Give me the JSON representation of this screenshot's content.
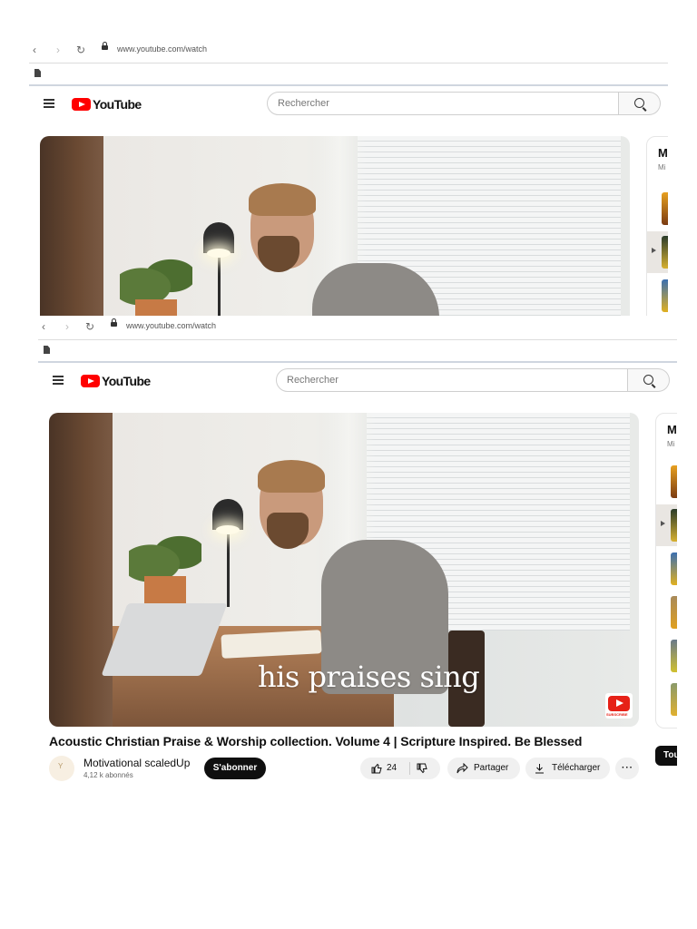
{
  "browser": {
    "url": "www.youtube.com/watch"
  },
  "header": {
    "logo_text": "YouTube",
    "search_placeholder": "Rechercher"
  },
  "video": {
    "caption": "his praises sing",
    "subscribe_badge_text": "SUBSCRIBE",
    "title": "Acoustic Christian Praise & Worship collection. Volume 4 | Scripture Inspired. Be Blessed"
  },
  "channel": {
    "name": "Motivational scaledUp",
    "subscribers": "4,12 k abonnés",
    "subscribe_label": "S'abonner"
  },
  "actions": {
    "likes": "24",
    "share_label": "Partager",
    "download_label": "Télécharger",
    "more_label": "···"
  },
  "sidebar": {
    "title_partial": "M",
    "subtitle_partial": "Mi",
    "button_partial": "Tou"
  },
  "colors": {
    "brand_red": "#ff0000",
    "subscribe_bg": "#0f0f0f",
    "pill_bg": "#f0f0f0"
  },
  "icons": [
    "back-icon",
    "forward-icon",
    "reload-icon",
    "lock-icon",
    "file-icon",
    "menu-icon",
    "search-icon",
    "like-icon",
    "dislike-icon",
    "share-icon",
    "download-icon",
    "more-icon",
    "play-icon"
  ]
}
